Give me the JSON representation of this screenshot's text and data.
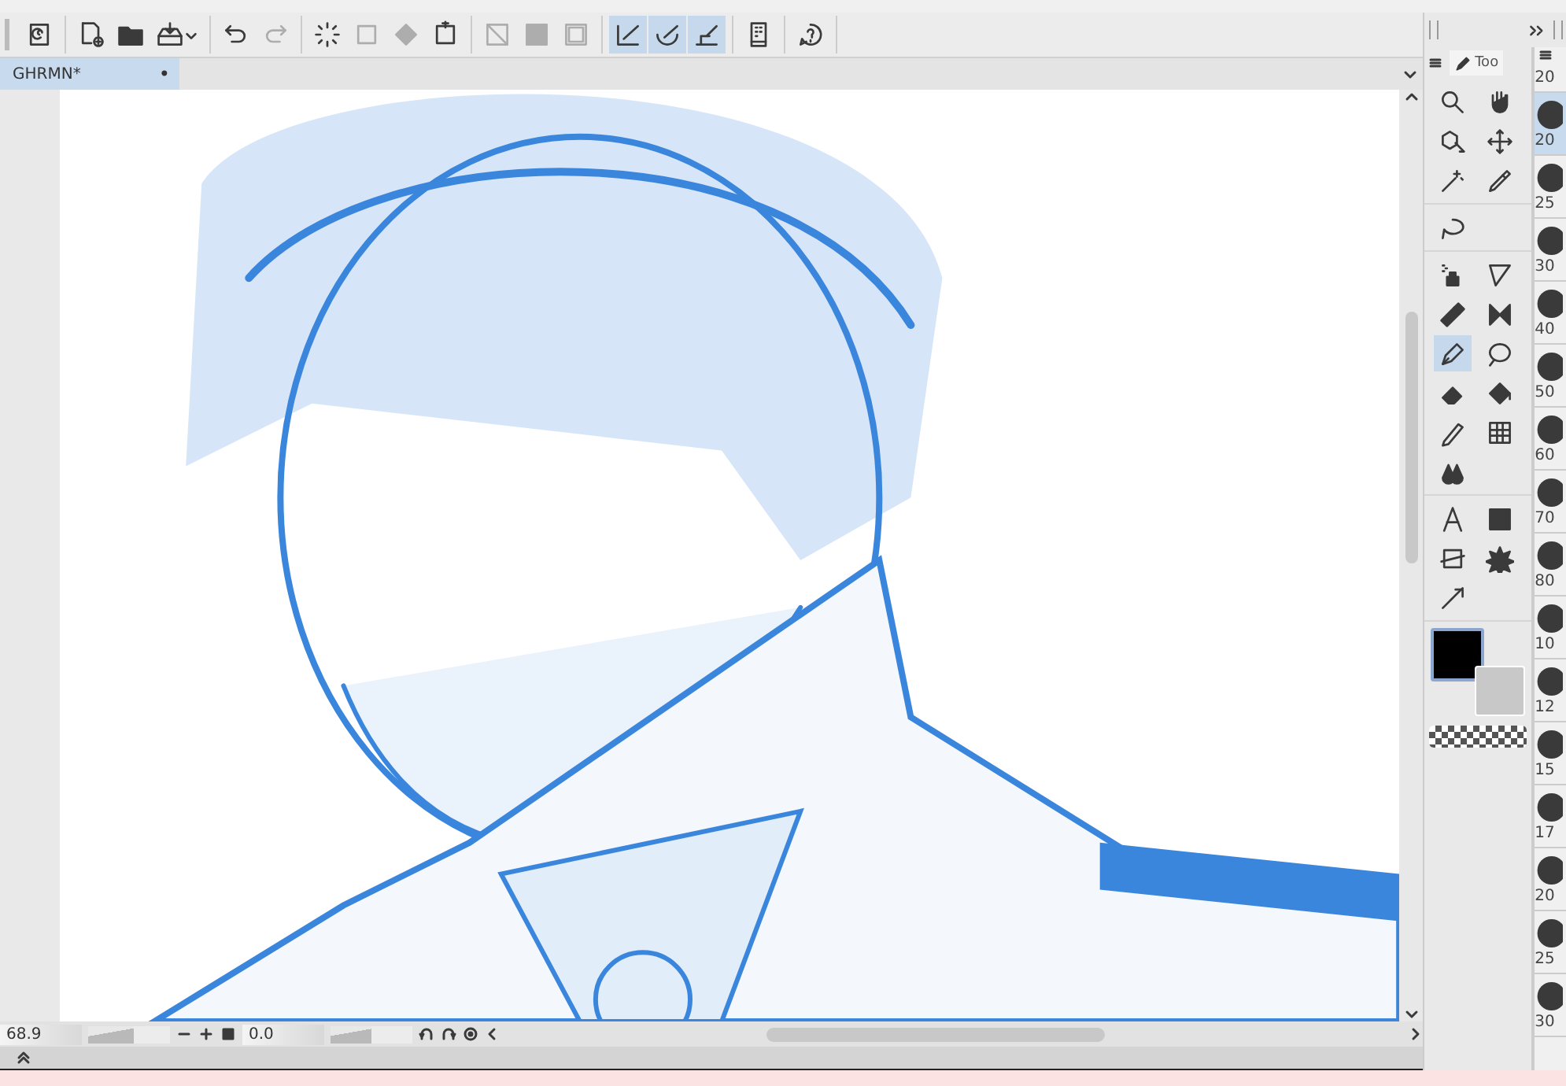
{
  "toolbar": [
    {
      "on": false,
      "disabled": false
    },
    {
      "on": false,
      "disabled": false
    },
    {
      "on": false,
      "disabled": false
    },
    {
      "on": false,
      "disabled": false
    },
    {
      "on": false,
      "disabled": false
    },
    {
      "on": false,
      "disabled": true
    },
    {
      "on": false,
      "disabled": false
    },
    {
      "on": false,
      "disabled": true
    },
    {
      "on": false,
      "disabled": true
    },
    {
      "on": false,
      "disabled": false
    },
    {
      "on": false,
      "disabled": true
    },
    {
      "on": false,
      "disabled": true
    },
    {
      "on": false,
      "disabled": true
    },
    {
      "on": true,
      "disabled": false
    },
    {
      "on": true,
      "disabled": false
    },
    {
      "on": true,
      "disabled": false
    },
    {
      "on": false,
      "disabled": false
    },
    {
      "on": false,
      "disabled": false
    }
  ],
  "document_tab": {
    "title": "GHRMN*",
    "mark": "•",
    "selected": true
  },
  "status_bar": {
    "zoom": "68.9",
    "zoom_slider": {
      "level": 0.55
    },
    "rotation": "0.0",
    "rotation_slider": {
      "level": 0.5
    }
  },
  "tool_panel": {
    "tab": "Too",
    "tools": [
      {
        "selected": false
      },
      {
        "selected": false
      },
      {
        "selected": false
      },
      {
        "selected": false
      },
      {
        "selected": false
      },
      {
        "selected": false
      },
      {
        "selected": false
      },
      {
        "selected": false
      },
      {
        "selected": false
      },
      {
        "selected": false
      },
      {
        "selected": false
      },
      {
        "selected": true
      },
      {
        "selected": false
      },
      {
        "selected": false
      },
      {
        "selected": false
      },
      {
        "selected": false
      },
      {
        "selected": false
      },
      {
        "selected": false
      },
      {
        "selected": false
      },
      {
        "selected": false
      },
      {
        "selected": false
      },
      {
        "selected": false
      },
      {
        "selected": false
      }
    ]
  },
  "brush_sizes": [
    {
      "size": "20",
      "selected": false
    },
    {
      "size": "20",
      "selected": true
    },
    {
      "size": "25",
      "selected": false
    },
    {
      "size": "30",
      "selected": false
    },
    {
      "size": "40",
      "selected": false
    },
    {
      "size": "50",
      "selected": false
    },
    {
      "size": "60",
      "selected": false
    },
    {
      "size": "70",
      "selected": false
    },
    {
      "size": "80",
      "selected": false
    },
    {
      "size": "10",
      "selected": false
    },
    {
      "size": "12",
      "selected": false
    },
    {
      "size": "15",
      "selected": false
    },
    {
      "size": "17",
      "selected": false
    },
    {
      "size": "20",
      "selected": false
    },
    {
      "size": "25",
      "selected": false
    },
    {
      "size": "30",
      "selected": false
    }
  ]
}
